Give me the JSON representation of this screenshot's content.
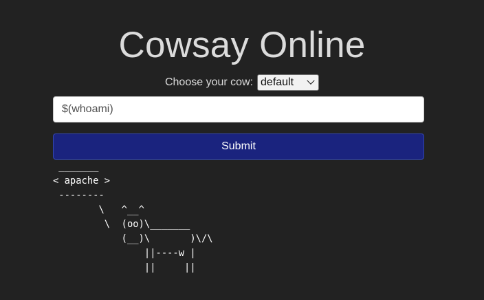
{
  "page": {
    "title": "Cowsay Online"
  },
  "form": {
    "cow_label": "Choose your cow:",
    "cow_selected": "default",
    "message_value": "$(whoami)",
    "submit_label": "Submit"
  },
  "output": {
    "ascii": " _______\n< apache >\n --------\n        \\   ^__^\n         \\  (oo)\\_______\n            (__)\\       )\\/\\\n                ||----w |\n                ||     ||"
  },
  "colors": {
    "background": "#222222",
    "button": "#1a237e",
    "text": "#dcdcdc"
  }
}
